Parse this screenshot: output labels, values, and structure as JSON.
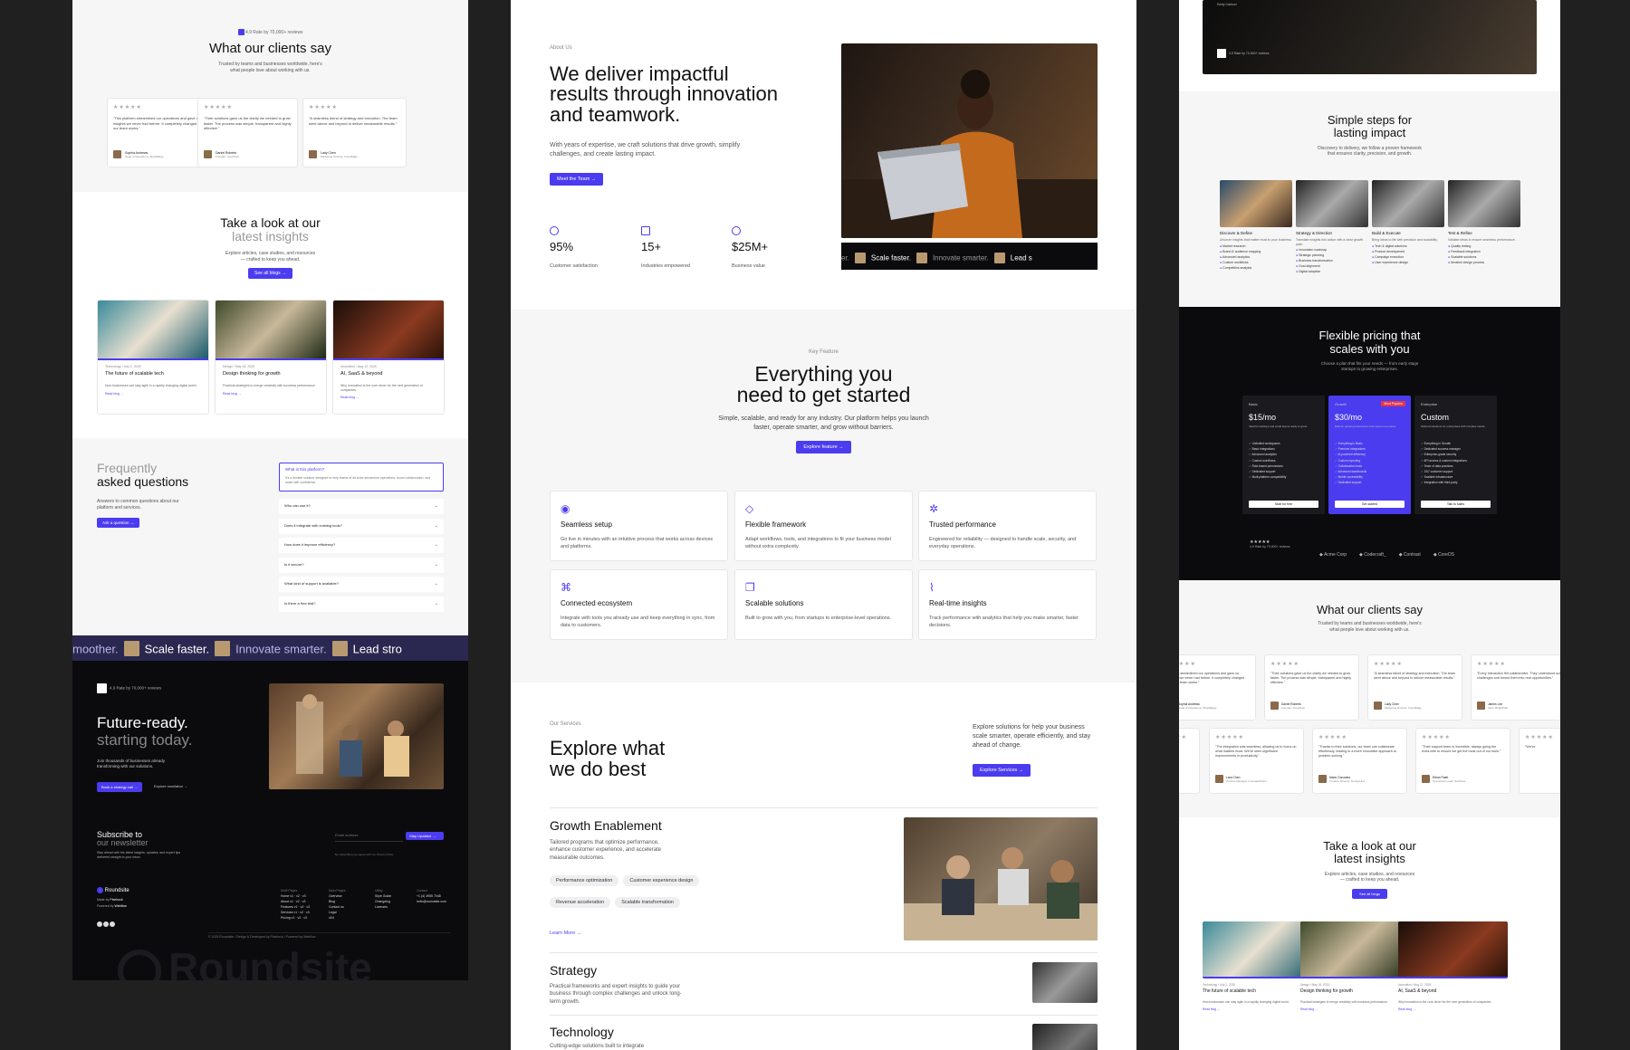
{
  "left": {
    "hero_top": {
      "rating": "4.9 Rate by 70,000+ reviews",
      "title": "What our clients say",
      "sub": "Trusted by teams and businesses worldwide, here's what people love about working with us."
    },
    "testimonials": [
      {
        "quote": "\"This platform streamlined our operations and gave us insights we never had before. It completely changed how our team works.\"",
        "name": "Sophia Andrews",
        "role": "Head of Operations, BrightEdge"
      },
      {
        "quote": "\"Their solutions gave us the clarity we needed to grow faster. The process was simple, transparent and highly effective.\"",
        "name": "Daniel Roberts",
        "role": "Founder, NovaTech"
      },
      {
        "quote": "\"A seamless blend of strategy and execution. The team went above and beyond to deliver measurable results.\"",
        "name": "Lady Chen",
        "role": "Marketing Director, CloudEdge"
      }
    ],
    "insights": {
      "title_a": "Take a look at our",
      "title_b": "latest insights",
      "sub": "Explore articles, case studies, and resources — crafted to keep you ahead.",
      "button": "See all blogs →"
    },
    "posts": [
      {
        "cat": "Technology",
        "date": "July 2, 2025",
        "title": "The future of scalable tech",
        "desc": "How businesses can stay agile in a rapidly changing digital world.",
        "link": "Read blog →"
      },
      {
        "cat": "Design",
        "date": "May 18, 2025",
        "title": "Design thinking for growth",
        "desc": "Practical strategies to merge creativity with business performance.",
        "link": "Read blog →"
      },
      {
        "cat": "Innovation",
        "date": "Aug 12, 2025",
        "title": "AI, SaaS & beyond",
        "desc": "Why innovation is the core driver for the next generation of companies.",
        "link": "Read blog →"
      }
    ],
    "faq": {
      "title_a": "Frequently",
      "title_b": "asked questions",
      "sub": "Answers to common questions about our platform and services.",
      "button": "Ask a question →",
      "open_q": "What is this platform?",
      "open_a": "It's a flexible solution designed to help teams of all sizes streamline operations, boost collaboration, and scale with confidence.",
      "items": [
        "Who can use it?",
        "Does it integrate with existing tools?",
        "How does it improve efficiency?",
        "Is it secure?",
        "What kind of support is available?",
        "Is there a free trial?"
      ]
    },
    "marquee": [
      "moother.",
      "Scale faster.",
      "Innovate smarter.",
      "Lead stro"
    ],
    "cta": {
      "rating": "4.9 Rate by 70,000+ reviews",
      "title_a": "Future-ready.",
      "title_b": "starting today.",
      "sub": "Join thousands of businesses already transforming with our solutions.",
      "button": "Book a strategy call →",
      "link": "Explore now/labor →"
    },
    "newsletter": {
      "title_a": "Subscribe to",
      "title_b": "our newsletter",
      "sub": "Stay ahead with the latest insights, updates, and expert tips delivered straight to your inbox.",
      "placeholder": "Email address",
      "button": "Stay Updated →",
      "note": "By subscribing you agree with our Privacy Policy"
    },
    "footer": {
      "brand": "Roundsite",
      "made_by": "Made by",
      "made_by_brand": "Pixelrock",
      "powered": "Powered by",
      "powered_brand": "Webflow",
      "cols": [
        {
          "head": "Multi Pages",
          "items": [
            "Home v1 · v2 · v3",
            "About v1 · v2 · v3",
            "Features v1 · v2 · v3",
            "Services v1 · v2 · v3",
            "Pricing v1 · v2 · v3"
          ]
        },
        {
          "head": "Main Pages",
          "items": [
            "Overview",
            "Blog",
            "Contact us",
            "Legal",
            "404"
          ]
        },
        {
          "head": "Utility",
          "items": [
            "Style Guide",
            "Changelog",
            "Licenses"
          ]
        },
        {
          "head": "Contact",
          "items": [
            "+1 (4) 3955 7048",
            "hello@roundsite.com"
          ]
        }
      ],
      "copyright": "© 2025 Roundsite  /  Design & Developed by Pixelrock  /  Powered by Webflow",
      "watermark": "Roundsite"
    }
  },
  "middle": {
    "about": {
      "eyebrow": "About Us",
      "title_a": "We deliver impactful",
      "title_b": "results through innovation",
      "title_c": "and teamwork.",
      "sub": "With years of expertise, we craft solutions that drive growth, simplify challenges, and create lasting impact.",
      "button": "Meet the Team →"
    },
    "stats": [
      {
        "value": "95%",
        "label": "Customer satisfaction"
      },
      {
        "value": "15+",
        "label": "Industries empowered"
      },
      {
        "value": "$25M+",
        "label": "Business value"
      }
    ],
    "marquee": [
      "er.",
      "Scale faster.",
      "Innovate smarter.",
      "Lead s"
    ],
    "features": {
      "eyebrow": "Key Feature",
      "title_a": "Everything you",
      "title_b": "need to get started",
      "sub": "Simple, scalable, and ready for any industry. Our platform helps you launch faster, operate smarter, and grow without barriers.",
      "button": "Explore feature →"
    },
    "feature_cards": [
      {
        "title": "Seamless setup",
        "desc": "Go live in minutes with an intuitive process that works across devices and platforms."
      },
      {
        "title": "Flexible framework",
        "desc": "Adapt workflows, tools, and integrations to fit your business model without extra complexity."
      },
      {
        "title": "Trusted performance",
        "desc": "Engineered for reliability — designed to handle scale, security, and everyday operations."
      },
      {
        "title": "Connected ecosystem",
        "desc": "Integrate with tools you already use and keep everything in sync, from data to customers."
      },
      {
        "title": "Scalable solutions",
        "desc": "Built to grow with you, from startups to enterprise-level operations."
      },
      {
        "title": "Real-time insights",
        "desc": "Track performance with analytics that help you make smarter, faster decisions."
      }
    ],
    "services": {
      "eyebrow": "Our Services",
      "title_a": "Explore what",
      "title_b": "we do best",
      "sub": "Explore solutions for help your business scale smarter, operate efficiently, and stay ahead of change.",
      "button": "Explore Services →"
    },
    "service_items": [
      {
        "title": "Growth Enablement",
        "desc": "Tailored programs that optimize performance, enhance customer experience, and accelerate measurable outcomes.",
        "tags": [
          "Performance optimization",
          "Customer experience design",
          "Revenue acceleration",
          "Scalable transformation"
        ],
        "link": "Learn More →"
      },
      {
        "title": "Strategy",
        "desc": "Practical frameworks and expert insights to guide your business through complex challenges and unlock long-term growth."
      },
      {
        "title": "Technology",
        "desc": "Cutting-edge solutions built to integrate"
      }
    ]
  },
  "right": {
    "top_rating": "4.9 Rate by 70,000+ reviews",
    "top_caption": "Emily Carlson",
    "steps": {
      "title_a": "Simple steps for",
      "title_b": "lasting impact",
      "sub": "Discovery to delivery, we follow a proven framework that ensures clarity, precision, and growth.",
      "items": [
        {
          "title": "Discover & Define",
          "desc": "Uncover insights that matter most to your business.",
          "bullets": [
            "Market research",
            "Brand & audience mapping",
            "Advanced analytics",
            "Custom workflows",
            "Competitive analysis"
          ]
        },
        {
          "title": "Strategy & Direction",
          "desc": "Translate insights into action with a clear growth path.",
          "bullets": [
            "Innovation roadmap",
            "Strategic planning",
            "Business transformation",
            "Goal alignment",
            "Digital adoption"
          ]
        },
        {
          "title": "Build & Execute",
          "desc": "Bring ideas to life with precision and scalability.",
          "bullets": [
            "Tech & digital solutions",
            "Product development",
            "Campaign execution",
            "User experience design"
          ]
        },
        {
          "title": "Test & Refine",
          "desc": "Validate ideas to ensure seamless performance.",
          "bullets": [
            "Quality testing",
            "Feedback integration",
            "Scalable solutions",
            "Iterative design process"
          ]
        }
      ]
    },
    "pricing": {
      "title_a": "Flexible pricing that",
      "title_b": "scales with you",
      "sub": "Choose a plan that fits your needs — from early stage startups to growing enterprises.",
      "plans": [
        {
          "name": "Basic",
          "price": "$15/mo",
          "desc": "Ideal for startups and small teams ready to grow.",
          "features": [
            "Unlimited workspaces",
            "Basic integrations",
            "Advanced analytics",
            "Custom workflows",
            "Role-based permissions",
            "Dedicated support",
            "Multi-platform compatibility"
          ],
          "button": "Start for free"
        },
        {
          "name": "Growth",
          "price": "$30/mo",
          "badge": "Most Popular",
          "desc": "Built for growing businesses that need more power.",
          "features": [
            "Everything in Basic",
            "Premium integrations",
            "AI-powered efficiency",
            "Custom reporting",
            "Collaboration tools",
            "Advanced dashboards",
            "Mobile accessibility",
            "Dedicated support"
          ],
          "button": "Get started"
        },
        {
          "name": "Enterprise",
          "price": "Custom",
          "desc": "Tailored solutions for enterprises with complex needs.",
          "features": [
            "Everything in Growth",
            "Dedicated success manager",
            "Enterprise-grade security",
            "API access & custom integrations",
            "Team of data practices",
            "24/7 customer support",
            "Scalable infrastructure",
            "Integration with third-party"
          ],
          "button": "Talk to sales"
        }
      ],
      "rating": "4.9 Rate by 70,000+ reviews",
      "logos": [
        "Acme Corp",
        "Codecraft_",
        "Contrast",
        "CoreOS"
      ]
    },
    "clients": {
      "title": "What our clients say",
      "sub": "Trusted by teams and businesses worldwide, here's what people love about working with us."
    },
    "quotes_row1": [
      {
        "quote": "platform streamlined our operations and gave us insights we never had before. It completely changed how our team works.\"",
        "name": "Sophia Andrews",
        "role": "Head of Operations, BrightEdge"
      },
      {
        "quote": "\"Their solutions gave us the clarity we needed to grow faster. The process was simple, transparent and highly effective.\"",
        "name": "Daniel Roberts",
        "role": "Founder, NovaTech"
      },
      {
        "quote": "\"A seamless blend of strategy and execution. The team went above and beyond to deliver measurable results.\"",
        "name": "Lady Chen",
        "role": "Marketing Director, CloudEdge"
      },
      {
        "quote": "\"Every interaction felt collaborative. They understood our challenges and turned them into real opportunities.\"",
        "name": "James Lee",
        "role": "CEO, BrightPath"
      }
    ],
    "quotes_row2": [
      {
        "quote": "impactful, and",
        "name": "",
        "role": ""
      },
      {
        "quote": "\"The integration was seamless, allowing us to focus on what matters most. We've seen significant improvements in productivity.\"",
        "name": "Lara Chen",
        "role": "Product Manager, InnovateWorks"
      },
      {
        "quote": "\"Thanks to their solutions, our team can collaborate effortlessly, leading to a more innovative approach to problem-solving.\"",
        "name": "Mario Gonzalez",
        "role": "Creative Director, DesignHive"
      },
      {
        "quote": "\"Their support team is incredible, always going the extra mile to ensure we get the most out of our tools.\"",
        "name": "Ethan Patel",
        "role": "Operations Lead, TechNest"
      },
      {
        "quote": "\"We've",
        "name": "",
        "role": ""
      }
    ],
    "insights": {
      "title_a": "Take a look at our",
      "title_b": "latest insights",
      "sub": "Explore articles, case studies, and resources — crafted to keep you ahead.",
      "button": "See all blogs"
    },
    "posts": [
      {
        "cat": "Technology",
        "date": "July 2, 2025",
        "title": "The future of scalable tech",
        "desc": "How businesses can stay agile in a rapidly changing digital world.",
        "link": "Read blog →"
      },
      {
        "cat": "Design",
        "date": "May 18, 2025",
        "title": "Design thinking for growth",
        "desc": "Practical strategies to merge creativity with business performance.",
        "link": "Read blog →"
      },
      {
        "cat": "Innovation",
        "date": "Aug 12, 2025",
        "title": "AI, SaaS & beyond",
        "desc": "Why innovation is the core driver for the next generation of companies.",
        "link": "Read blog →"
      }
    ]
  },
  "colors": {
    "accent": "#4b3cf0",
    "dark": "#0b0b0d",
    "canvas": "#202020"
  }
}
